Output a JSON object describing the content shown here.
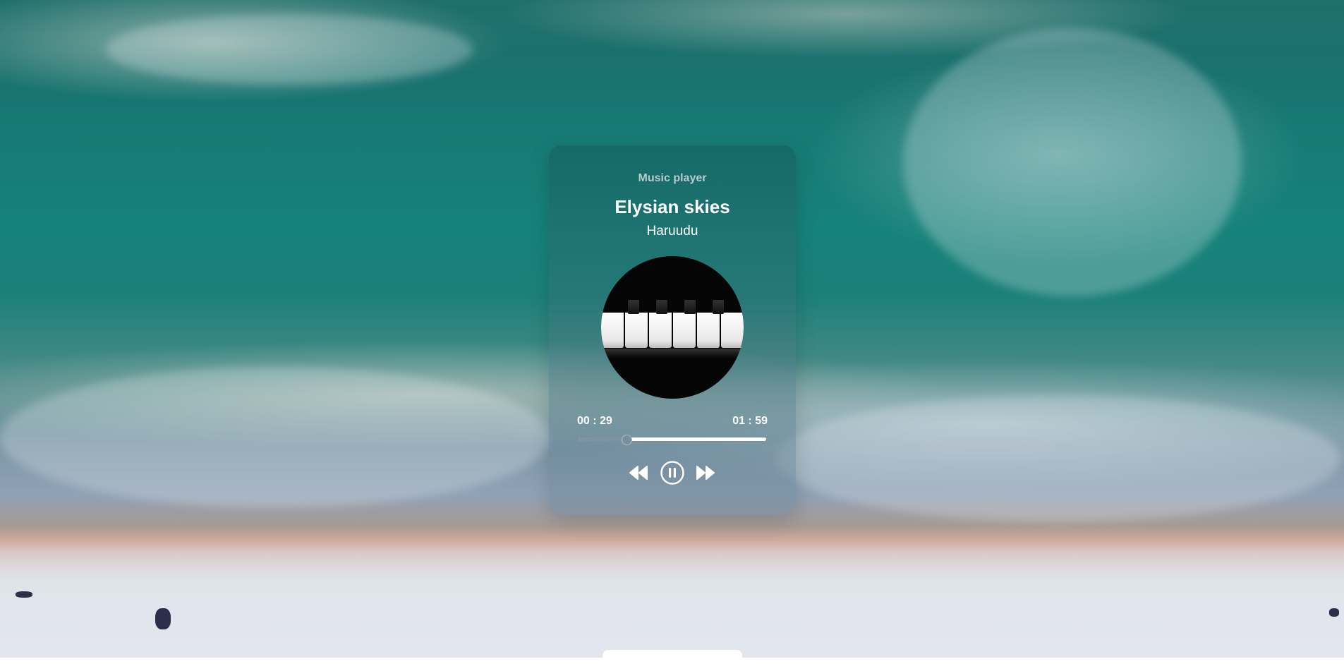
{
  "player": {
    "app_title": "Music player",
    "song_title": "Elysian skies",
    "artist": "Haruudu",
    "current_time": "00 : 29",
    "total_time": "01 : 59",
    "progress_fraction": 0.25,
    "icons": {
      "rewind": "rewind-icon",
      "pause": "pause-icon",
      "forward": "fast-forward-icon"
    }
  }
}
